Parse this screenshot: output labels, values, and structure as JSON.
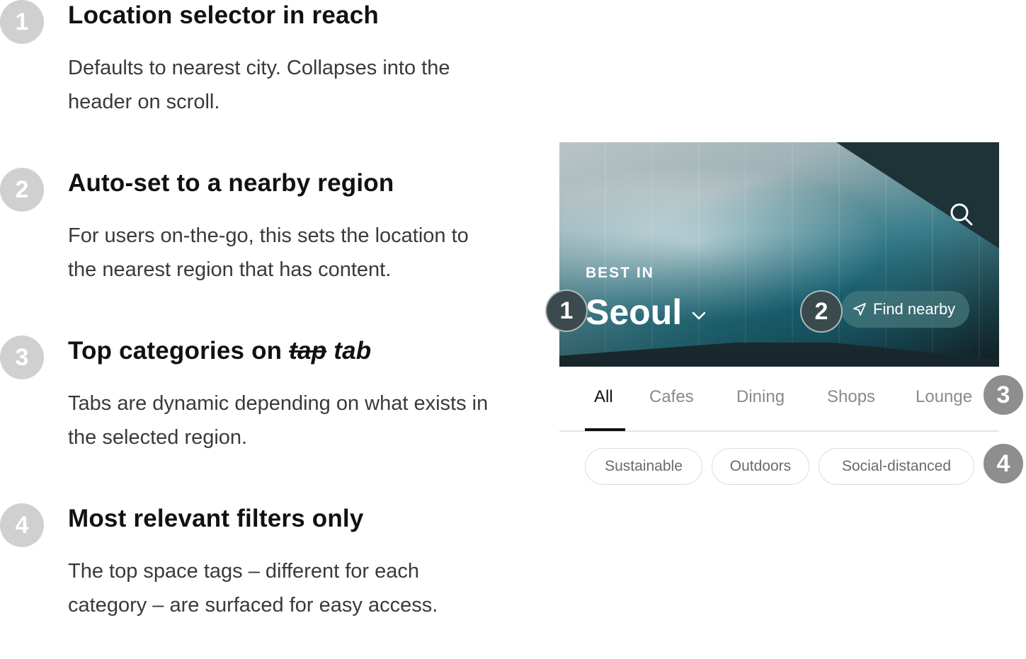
{
  "notes": [
    {
      "number": "1",
      "title": "Location selector in reach",
      "description": "Defaults to nearest city. Collapses into the header on scroll."
    },
    {
      "number": "2",
      "title": "Auto-set to a nearby region",
      "description": "For users on-the-go, this sets the location to the nearest region that has content."
    },
    {
      "number": "3",
      "title_prefix": "Top categories on",
      "title_struck": "tap",
      "title_suffix": "tab",
      "description": "Tabs are dynamic depending on what exists in the selected region."
    },
    {
      "number": "4",
      "title": "Most relevant filters only",
      "description": "The top space tags – different for each category – are surfaced for easy access."
    }
  ],
  "mock": {
    "eyebrow": "BEST IN",
    "city": "Seoul",
    "find_nearby_label": "Find nearby",
    "search_icon": "search-icon",
    "chevron_icon": "chevron-down-icon",
    "location_icon": "navigation-arrow-icon",
    "tabs": [
      "All",
      "Cafes",
      "Dining",
      "Shops",
      "Lounge"
    ],
    "active_tab": "All",
    "chips": [
      "Sustainable",
      "Outdoors",
      "Social-distanced"
    ],
    "badges": [
      "1",
      "2",
      "3",
      "4"
    ]
  },
  "colors": {
    "badge_light": "#d0d0d0",
    "badge_dark": "#3b4a4c",
    "badge_grey": "#8e8e8e",
    "active_tab": "#111111",
    "inactive_tab": "#8a8a8a"
  }
}
